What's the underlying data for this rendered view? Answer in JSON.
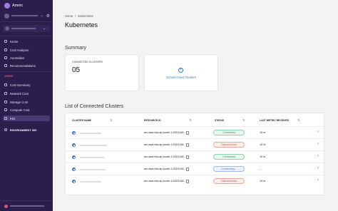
{
  "brand": {
    "name": "Amnic"
  },
  "sidebar": {
    "items": [
      {
        "label": "Home",
        "icon": "home-icon"
      },
      {
        "label": "Cost Analyzer",
        "icon": "chart-icon"
      },
      {
        "label": "Anomalies",
        "icon": "alert-icon"
      },
      {
        "label": "Recommendations",
        "icon": "bulb-icon"
      }
    ],
    "section_views": "VIEWS",
    "views": [
      {
        "label": "Cost Summary",
        "icon": "summary-icon"
      },
      {
        "label": "Network Cost",
        "icon": "network-icon"
      },
      {
        "label": "Storage Cost",
        "icon": "storage-icon"
      },
      {
        "label": "Compute Cost",
        "icon": "compute-icon"
      },
      {
        "label": "K8s",
        "icon": "k8s-icon",
        "active": true
      }
    ],
    "environment": "ENVIRONMENT 360"
  },
  "breadcrumb": {
    "home": "Home",
    "separator": "/",
    "current": "Kubernetes"
  },
  "page_title": "Kubernetes",
  "summary": {
    "title": "Summary",
    "connected_label": "CONNECTED CLUSTERS",
    "connected_value": "05",
    "connect_new": "Connect New Clusters"
  },
  "clusters": {
    "title": "List of Connected Clusters",
    "columns": {
      "name": "CLUSTER NAME",
      "resource": "RESOURCE ID",
      "status": "STATUS",
      "metric": "LAST METRIC RECEIVED"
    },
    "rows": [
      {
        "resource_id": "arn:aws:eks:ap-south-1:9324148...",
        "status": "Connected",
        "metric": "10 hr"
      },
      {
        "resource_id": "arn:aws:eks:ap-south-1:9324148...",
        "status": "Disconnected",
        "metric": "10 hr"
      },
      {
        "resource_id": "arn:aws:eks:ap-south-1:9324148...",
        "status": "Connected",
        "metric": "10 hr"
      },
      {
        "resource_id": "arn:aws:eks:ap-south-1:9324148...",
        "status": "Connecting...",
        "metric": "--"
      },
      {
        "resource_id": "arn:aws:eks:ap-south-1:9324148...",
        "status": "Disconnected",
        "metric": "10 hr"
      }
    ]
  },
  "colors": {
    "sidebar_bg": "#2b1d4c",
    "accent": "#3a74d8",
    "connected": "#2e8b57",
    "disconnected": "#d05040"
  }
}
